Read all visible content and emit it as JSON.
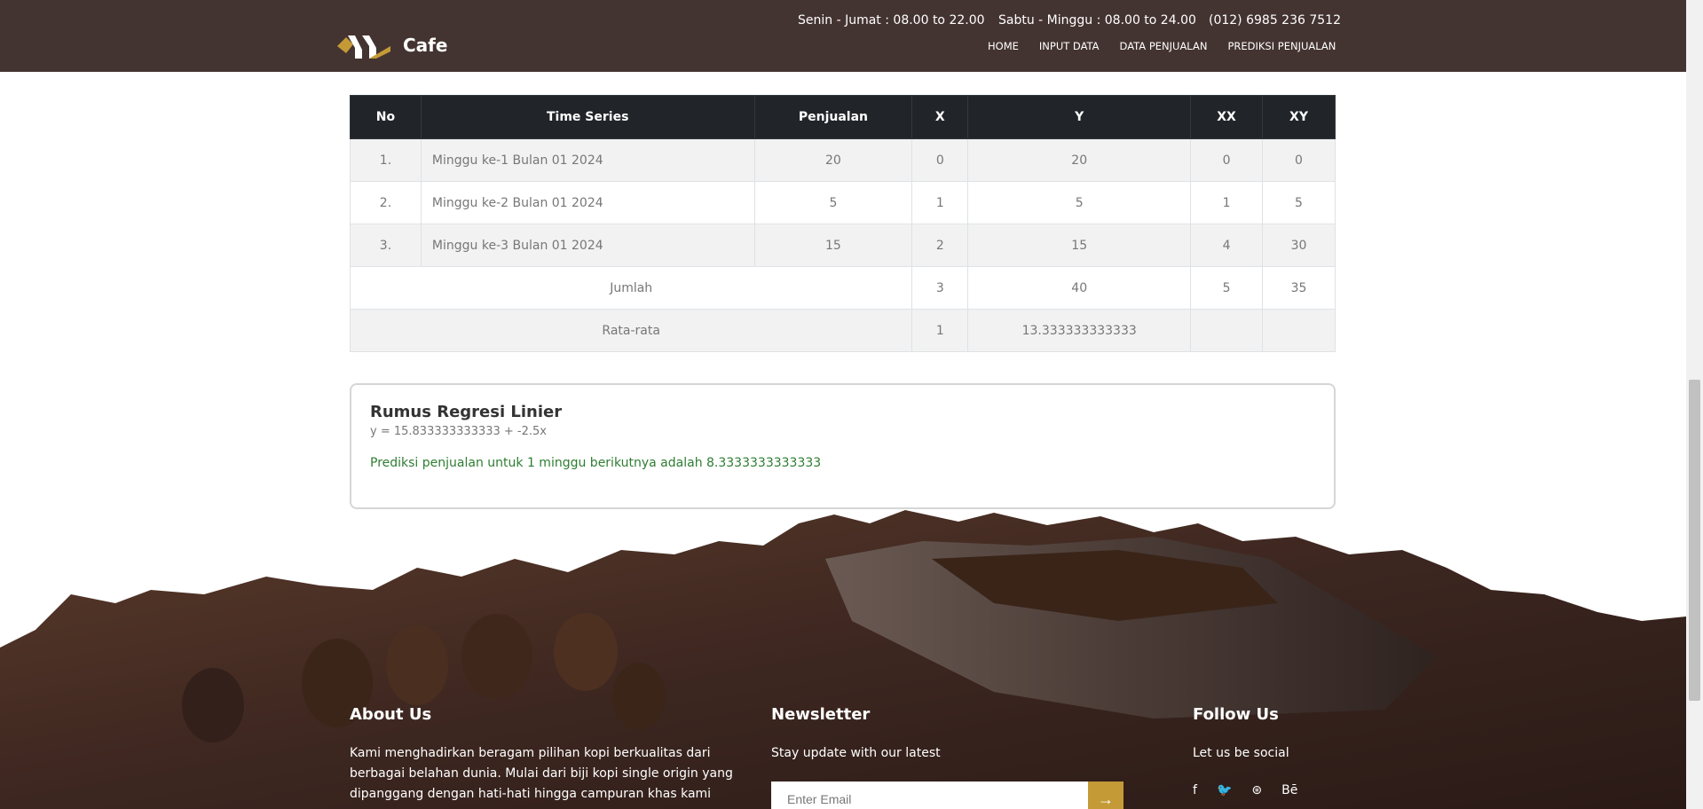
{
  "header": {
    "brand": "Cafe",
    "hours_weekday": "Senin - Jumat : 08.00 to 22.00",
    "hours_weekend": "Sabtu - Minggu : 08.00 to 24.00",
    "phone": "(012) 6985 236 7512",
    "nav": [
      "HOME",
      "INPUT DATA",
      "DATA PENJUALAN",
      "PREDIKSI PENJUALAN"
    ]
  },
  "table": {
    "headers": [
      "No",
      "Time Series",
      "Penjualan",
      "X",
      "Y",
      "XX",
      "XY"
    ],
    "rows": [
      [
        "1.",
        "Minggu ke-1 Bulan 01 2024",
        "20",
        "0",
        "20",
        "0",
        "0"
      ],
      [
        "2.",
        "Minggu ke-2 Bulan 01 2024",
        "5",
        "1",
        "5",
        "1",
        "5"
      ],
      [
        "3.",
        "Minggu ke-3 Bulan 01 2024",
        "15",
        "2",
        "15",
        "4",
        "30"
      ]
    ],
    "total": {
      "label": "Jumlah",
      "x": "3",
      "y": "40",
      "xx": "5",
      "xy": "35"
    },
    "average": {
      "label": "Rata-rata",
      "x": "1",
      "y": "13.333333333333",
      "xx": "",
      "xy": ""
    }
  },
  "regression": {
    "title": "Rumus Regresi Linier",
    "formula": "y = 15.833333333333 + -2.5x",
    "prediction": "Prediksi penjualan untuk 1 minggu berikutnya adalah 8.3333333333333"
  },
  "footer": {
    "about_title": "About Us",
    "about_text": "Kami menghadirkan beragam pilihan kopi berkualitas dari berbagai belahan dunia. Mulai dari biji kopi single origin yang dipanggang dengan hati-hati hingga campuran khas kami",
    "newsletter_title": "Newsletter",
    "newsletter_text": "Stay update with our latest",
    "email_placeholder": "Enter Email",
    "submit_icon": "→",
    "follow_title": "Follow Us",
    "follow_text": "Let us be social",
    "social": [
      "f",
      "🐦",
      "⊛",
      "Bē"
    ],
    "social_icons": [
      "facebook-icon",
      "twitter-icon",
      "dribbble-icon",
      "behance-icon"
    ]
  },
  "colors": {
    "header_bg": "#443431",
    "accent": "#c49a37",
    "table_head": "#212529",
    "prediction_green": "#2e7d32"
  }
}
